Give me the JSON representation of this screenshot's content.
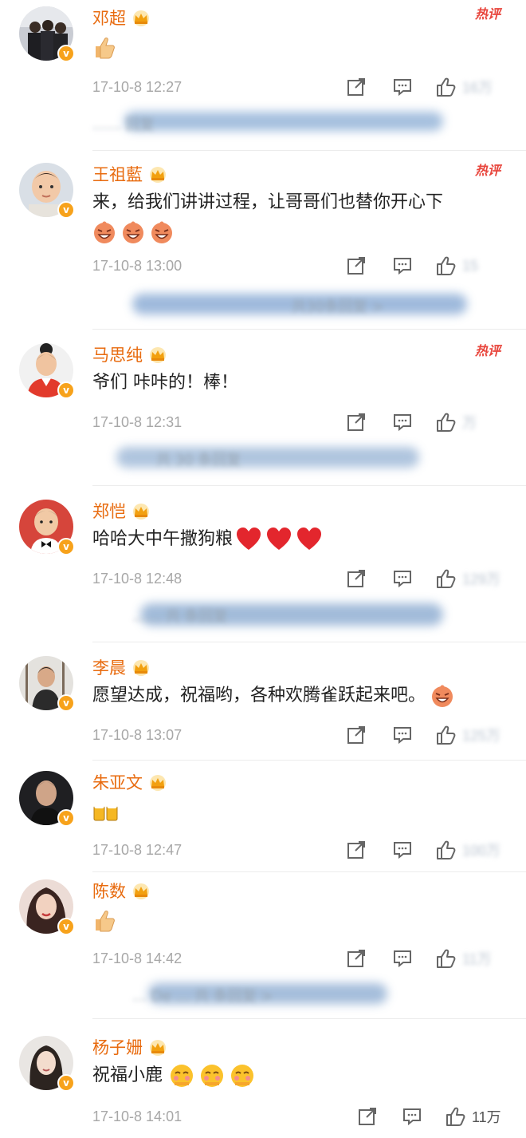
{
  "hot_label": "热评",
  "verified_mark": "v",
  "comments": [
    {
      "name": "邓超",
      "text": "",
      "emoji": [
        "thumbs-up"
      ],
      "time": "17-10-8 12:27",
      "likes": "16万",
      "likes_blurred": true,
      "reply_text": "…… 回复",
      "hot": true
    },
    {
      "name": "王祖藍",
      "text": "来，给我们讲讲过程，让哥哥们也替你开心下",
      "emoji": [
        "laughing-face",
        "laughing-face",
        "laughing-face"
      ],
      "time": "17-10-8 13:00",
      "likes": "15",
      "likes_blurred": true,
      "reply_text": "共30条回复 >",
      "hot": true
    },
    {
      "name": "马思纯",
      "text": "爷们 咔咔的！棒！",
      "emoji": [],
      "time": "17-10-8 12:31",
      "likes": "万",
      "likes_blurred": true,
      "reply_text": "共 30 条回复",
      "hot": true
    },
    {
      "name": "郑恺",
      "text": "哈哈大中午撒狗粮",
      "emoji": [
        "red-heart",
        "red-heart",
        "red-heart"
      ],
      "time": "17-10-8 12:48",
      "likes": "129万",
      "likes_blurred": true,
      "reply_text": "…… 共 条回复",
      "hot": false
    },
    {
      "name": "李晨",
      "text": "愿望达成，祝福哟，各种欢腾雀跃起来吧。",
      "emoji": [
        "laughing-face"
      ],
      "time": "17-10-8 13:07",
      "likes": "125万",
      "likes_blurred": true,
      "reply_text": "",
      "hot": false
    },
    {
      "name": "朱亚文",
      "text": "",
      "emoji": [
        "beer-mugs"
      ],
      "time": "17-10-8 12:47",
      "likes": "100万",
      "likes_blurred": true,
      "reply_text": "",
      "hot": false
    },
    {
      "name": "陈数",
      "text": "",
      "emoji": [
        "thumbs-up"
      ],
      "time": "17-10-8 14:42",
      "likes": "11万",
      "likes_blurred": true,
      "reply_text": "… De … 共 条回复 >",
      "hot": false
    },
    {
      "name": "杨子姗",
      "text": "祝福小鹿",
      "emoji": [
        "blushing-face",
        "blushing-face",
        "blushing-face"
      ],
      "time": "17-10-8 14:01",
      "likes": "11万",
      "likes_blurred": false,
      "reply_text": "",
      "hot": false
    }
  ],
  "colors": {
    "name": "#e86b0f",
    "hot": "#e8453c",
    "time": "#a7a7a7",
    "badge": "#f7a21b",
    "blur": "#7fa7d3"
  },
  "icons": {
    "share": "share-icon",
    "comment": "comment-icon",
    "like": "like-icon",
    "crown": "crown-icon"
  }
}
